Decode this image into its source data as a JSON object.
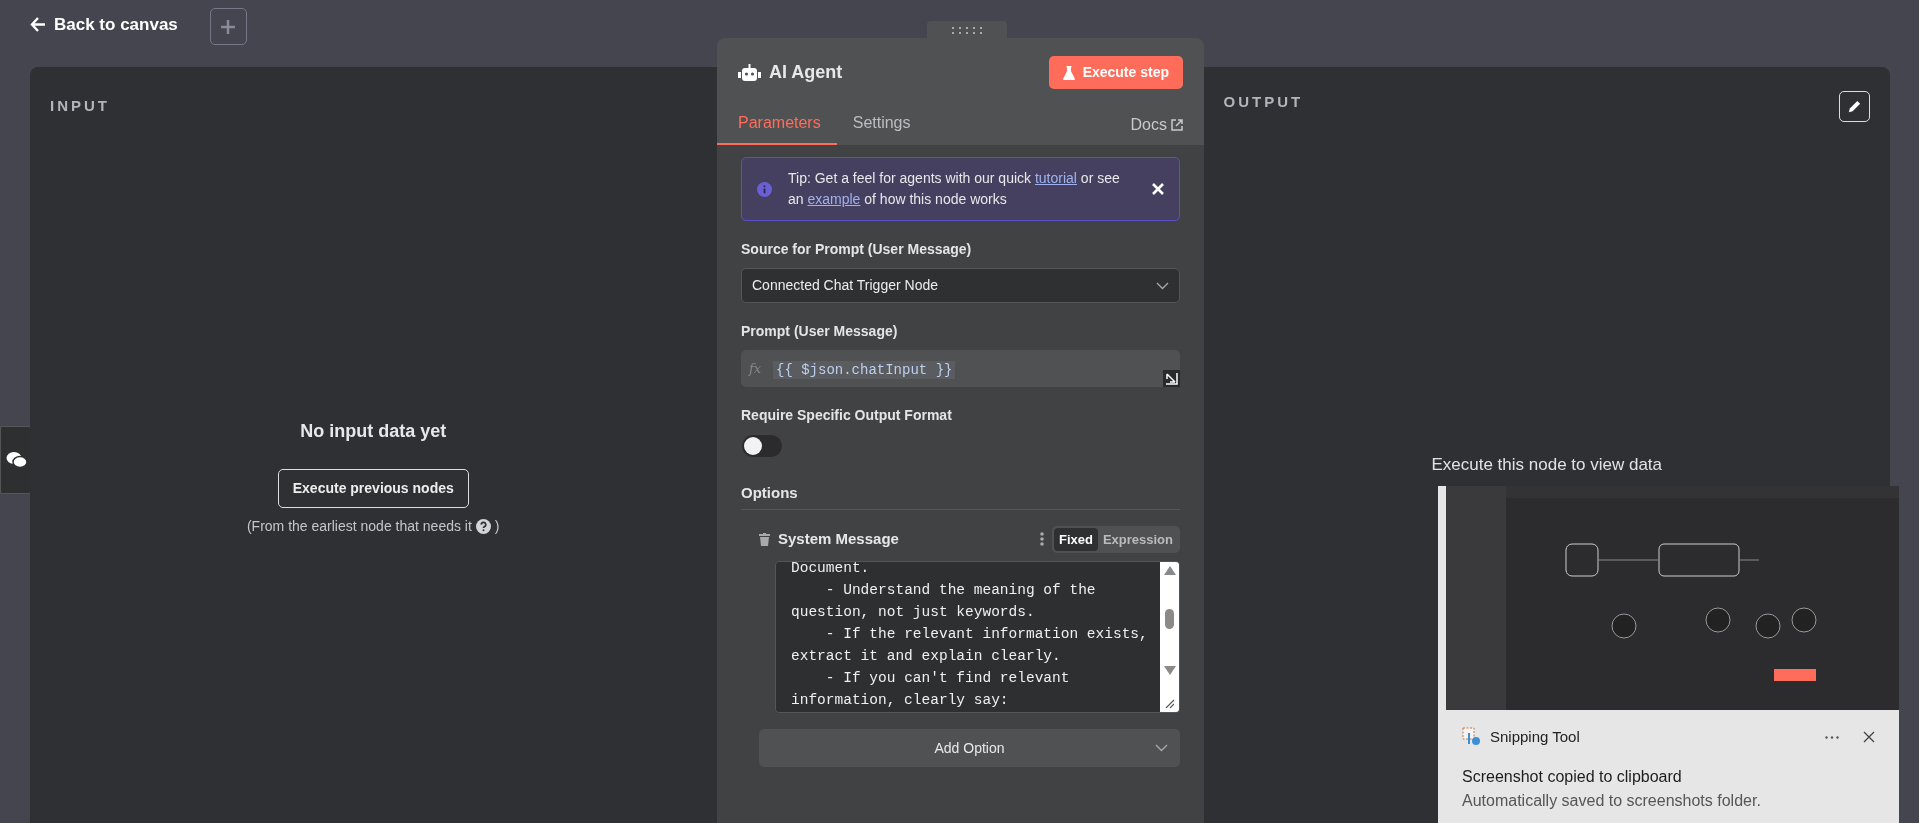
{
  "top_bar": {
    "back_link": "Back to canvas"
  },
  "input_panel": {
    "heading": "INPUT",
    "empty_title": "No input data yet",
    "button": "Execute previous nodes",
    "hint_before": "(From the earliest node that needs it",
    "hint_after": ")"
  },
  "node_panel": {
    "title": "AI Agent",
    "execute_button": "Execute step",
    "tabs": [
      {
        "label": "Parameters",
        "selected": true
      },
      {
        "label": "Settings",
        "selected": false
      }
    ],
    "docs_link": "Docs",
    "tip": {
      "parts": [
        {
          "kind": "text",
          "text": "Tip: Get a feel for agents with our quick "
        },
        {
          "kind": "link",
          "text": "tutorial"
        },
        {
          "kind": "text",
          "text": " or see an "
        },
        {
          "kind": "link",
          "text": "example"
        },
        {
          "kind": "text",
          "text": " of how this node works"
        }
      ]
    },
    "source_field": {
      "label": "Source for Prompt (User Message)",
      "value": "Connected Chat Trigger Node"
    },
    "prompt_field": {
      "label": "Prompt (User Message)",
      "prefix": "fx",
      "value": "{{ $json.chatInput }}"
    },
    "output_format": {
      "label": "Require Specific Output Format",
      "on": false
    },
    "options": {
      "heading": "Options",
      "system_message": {
        "label": "System Message",
        "modes": [
          {
            "label": "Fixed",
            "selected": true
          },
          {
            "label": "Expression",
            "selected": false
          }
        ],
        "text": "Document.\n    - Understand the meaning of the question, not just keywords.\n    - If the relevant information exists, extract it and explain clearly.\n    - If you can't find relevant information, clearly say:"
      },
      "add_option": "Add Option"
    }
  },
  "output_panel": {
    "heading": "OUTPUT",
    "empty_message": "Execute this node to view data"
  },
  "notification": {
    "app": "Snipping Tool",
    "title": "Screenshot copied to clipboard",
    "message": "Automatically saved to screenshots folder."
  }
}
